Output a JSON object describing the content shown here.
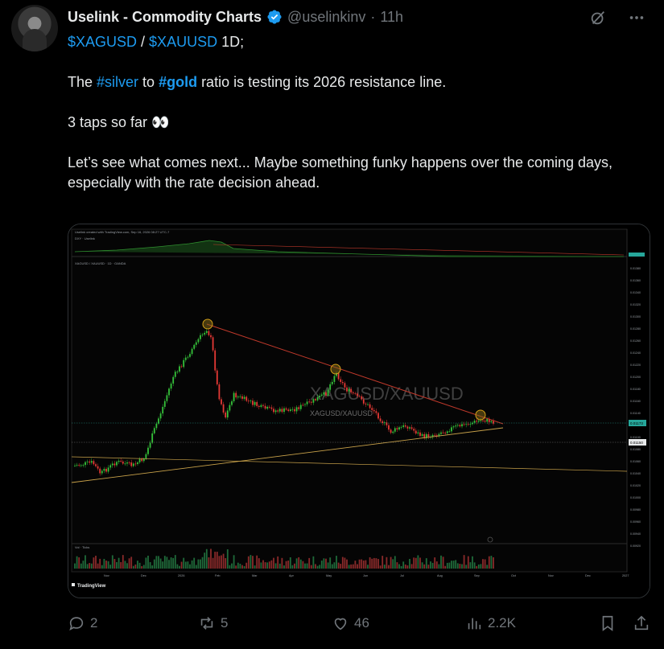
{
  "tweet": {
    "display_name": "Uselink - Commodity Charts",
    "handle": "@uselinkinv",
    "separator": "·",
    "time": "11h",
    "line1": {
      "ticker1": "$XAGUSD",
      "slash": " / ",
      "ticker2": "$XAUUSD",
      "rest": " 1D;"
    },
    "line2": {
      "pre": "The ",
      "tag1": "#silver",
      "mid": " to ",
      "tag2": "#gold",
      "post": " ratio is testing its 2026 resistance line."
    },
    "line3": "3 taps so far 👀",
    "line4": "Let’s see what comes next... Maybe something funky happens over the coming days, especially with the rate decision ahead."
  },
  "chart": {
    "header": "Uselink created with TradingView.com, Sep 16, 2026 08:27 UTC-7",
    "top_panel_label": "DXY  ·  Uselink",
    "symbol_label": "XAGUSD / XAUUSD · 1D · OANDA",
    "watermark_big": "XAGUSD/XAUUSD",
    "watermark_small": "XAGUSD/XAUUSD",
    "volume_label": "Vol · Ticks",
    "tradingview_label": "TradingView",
    "x_labels": [
      "Nov",
      "Dec",
      "2026",
      "Feb",
      "Mar",
      "Apr",
      "May",
      "Jun",
      "Jul",
      "Aug",
      "Sep",
      "Oct",
      "Nov",
      "Dec",
      "2027"
    ],
    "price_labels": [
      "0.01380",
      "0.01360",
      "0.01340",
      "0.01320",
      "0.01300",
      "0.01280",
      "0.01260",
      "0.01240",
      "0.01220",
      "0.01200",
      "0.01180",
      "0.01160",
      "0.01140",
      "0.01120",
      "0.01100",
      "0.01080",
      "0.01060",
      "0.01040",
      "0.01020",
      "0.01000",
      "0.00980",
      "0.00960",
      "0.00940",
      "0.00920"
    ],
    "current_price": "0.01173",
    "support_price": "0.01150",
    "colors": {
      "up": "#26a69a",
      "bull": "#35c23a",
      "bear": "#e53935",
      "trend": "#c0392b",
      "support": "#c9a24a",
      "tap": "#d4a017"
    }
  },
  "actions": {
    "replies": "2",
    "reposts": "5",
    "likes": "46",
    "views": "2.2K"
  }
}
